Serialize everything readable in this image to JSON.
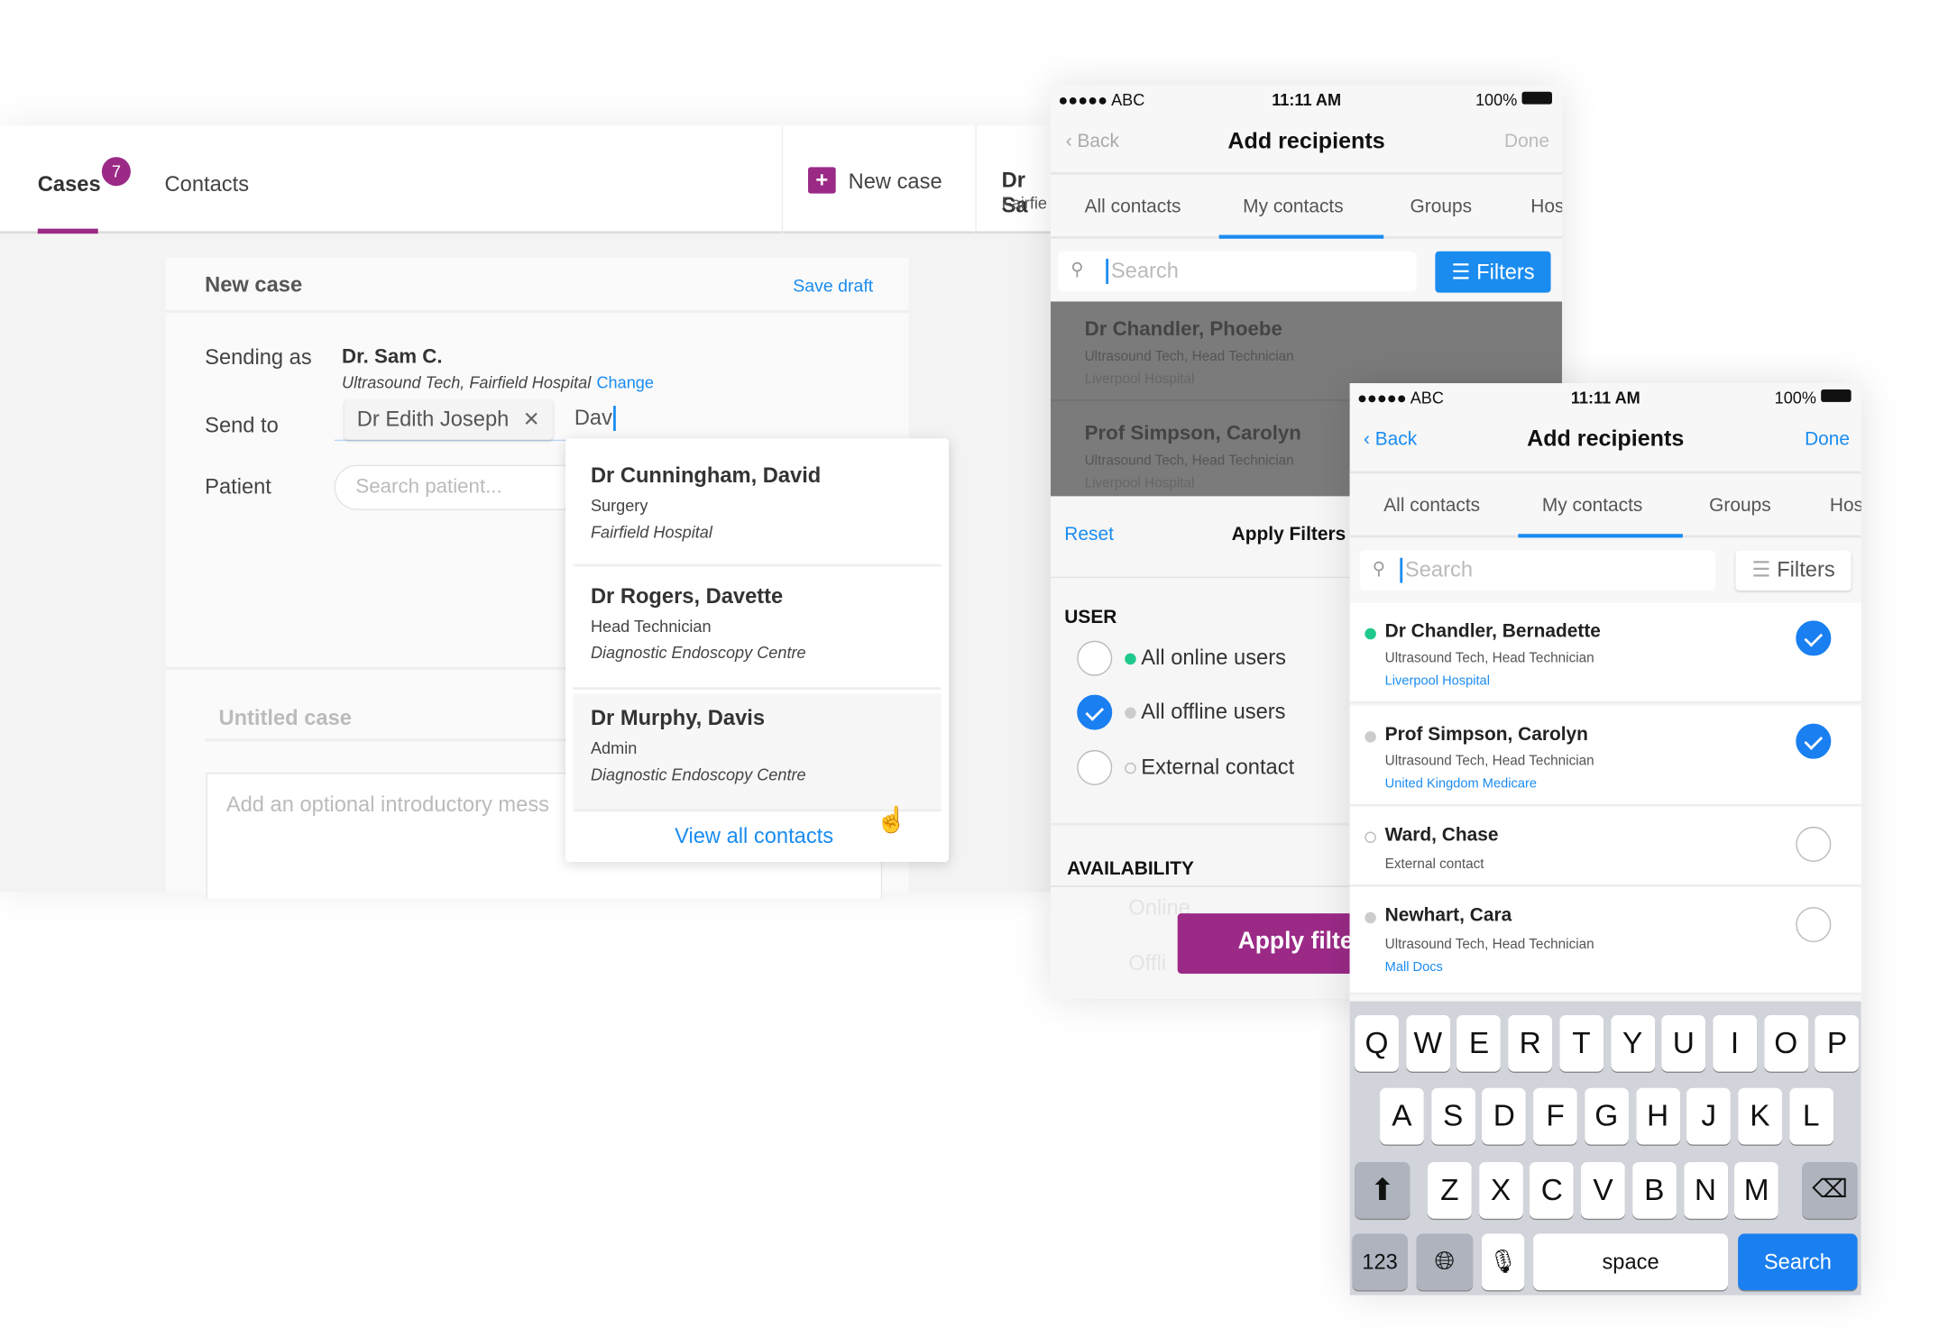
{
  "desktop": {
    "tabs": [
      {
        "label": "Cases",
        "badge": "7"
      },
      {
        "label": "Contacts"
      }
    ],
    "new_case_label": "New case",
    "user_name": "Dr Sa",
    "user_org": "Fairfie",
    "card": {
      "title": "New case",
      "save_draft": "Save draft",
      "sending_as_label": "Sending as",
      "sender_name": "Dr. Sam C.",
      "sender_info": "Ultrasound Tech, Fairfield Hospital",
      "change_link": "Change",
      "send_to_label": "Send to",
      "recipient_chip": "Dr Edith Joseph",
      "chip_remove": "✕",
      "send_to_value": "Dav",
      "patient_label": "Patient",
      "patient_placeholder": "Search patient...",
      "title_placeholder": "Untitled case",
      "message_placeholder": "Add an optional introductory mess"
    },
    "suggestions": [
      {
        "name": "Dr Cunningham, David",
        "role": "Surgery",
        "org": "Fairfield Hospital"
      },
      {
        "name": "Dr Rogers, Davette",
        "role": "Head Technician",
        "org": "Diagnostic Endoscopy Centre"
      },
      {
        "name": "Dr Murphy, Davis",
        "role": "Admin",
        "org": "Diagnostic Endoscopy Centre"
      }
    ],
    "view_all": "View all contacts"
  },
  "phone_status": {
    "carrier": "●●●●● ABC",
    "time": "11:11 AM",
    "battery": "100%"
  },
  "phone1": {
    "back": "Back",
    "title": "Add recipients",
    "done": "Done",
    "tabs": [
      "All contacts",
      "My contacts",
      "Groups",
      "Hos"
    ],
    "search_placeholder": "Search",
    "filters": "Filters",
    "contacts": [
      {
        "name": "Dr Chandler, Phoebe",
        "role": "Ultrasound Tech, Head Technician",
        "org": "Liverpool Hospital"
      },
      {
        "name": "Prof Simpson, Carolyn",
        "role": "Ultrasound Tech, Head Technician",
        "org": "Liverpool Hospital"
      }
    ],
    "filter_sheet": {
      "reset": "Reset",
      "title": "Apply Filters",
      "user_heading": "USER",
      "user_options": [
        {
          "label": "All online users",
          "checked": false
        },
        {
          "label": "All offline users",
          "checked": true
        },
        {
          "label": "External contact",
          "checked": false
        }
      ],
      "availability_heading": "AVAILABILITY",
      "availability_options": [
        "Online",
        "Offli"
      ],
      "apply_button": "Apply filte"
    }
  },
  "phone2": {
    "back": "Back",
    "title": "Add recipients",
    "done": "Done",
    "tabs": [
      "All contacts",
      "My contacts",
      "Groups",
      "Hos"
    ],
    "search_placeholder": "Search",
    "filters": "Filters",
    "contacts": [
      {
        "name": "Dr Chandler, Bernadette",
        "role": "Ultrasound Tech, Head Technician",
        "org": "Liverpool Hospital",
        "status": "online",
        "selected": true
      },
      {
        "name": "Prof Simpson, Carolyn",
        "role": "Ultrasound Tech, Head Technician",
        "org": "United Kingdom Medicare",
        "status": "offline",
        "selected": true
      },
      {
        "name": "Ward, Chase",
        "role": "External contact",
        "org": "",
        "status": "external",
        "selected": false
      },
      {
        "name": "Newhart, Cara",
        "role": "Ultrasound Tech, Head Technician",
        "org": "Mall Docs",
        "status": "offline",
        "selected": false
      }
    ],
    "keyboard": {
      "row1": [
        "Q",
        "W",
        "E",
        "R",
        "T",
        "Y",
        "U",
        "I",
        "O",
        "P"
      ],
      "row2": [
        "A",
        "S",
        "D",
        "F",
        "G",
        "H",
        "J",
        "K",
        "L"
      ],
      "row3": [
        "Z",
        "X",
        "C",
        "V",
        "B",
        "N",
        "M"
      ],
      "numbers": "123",
      "space": "space",
      "search": "Search"
    }
  },
  "colors": {
    "brand": "#9b2a87",
    "accent": "#1a8cf0",
    "online": "#1ec98b"
  }
}
